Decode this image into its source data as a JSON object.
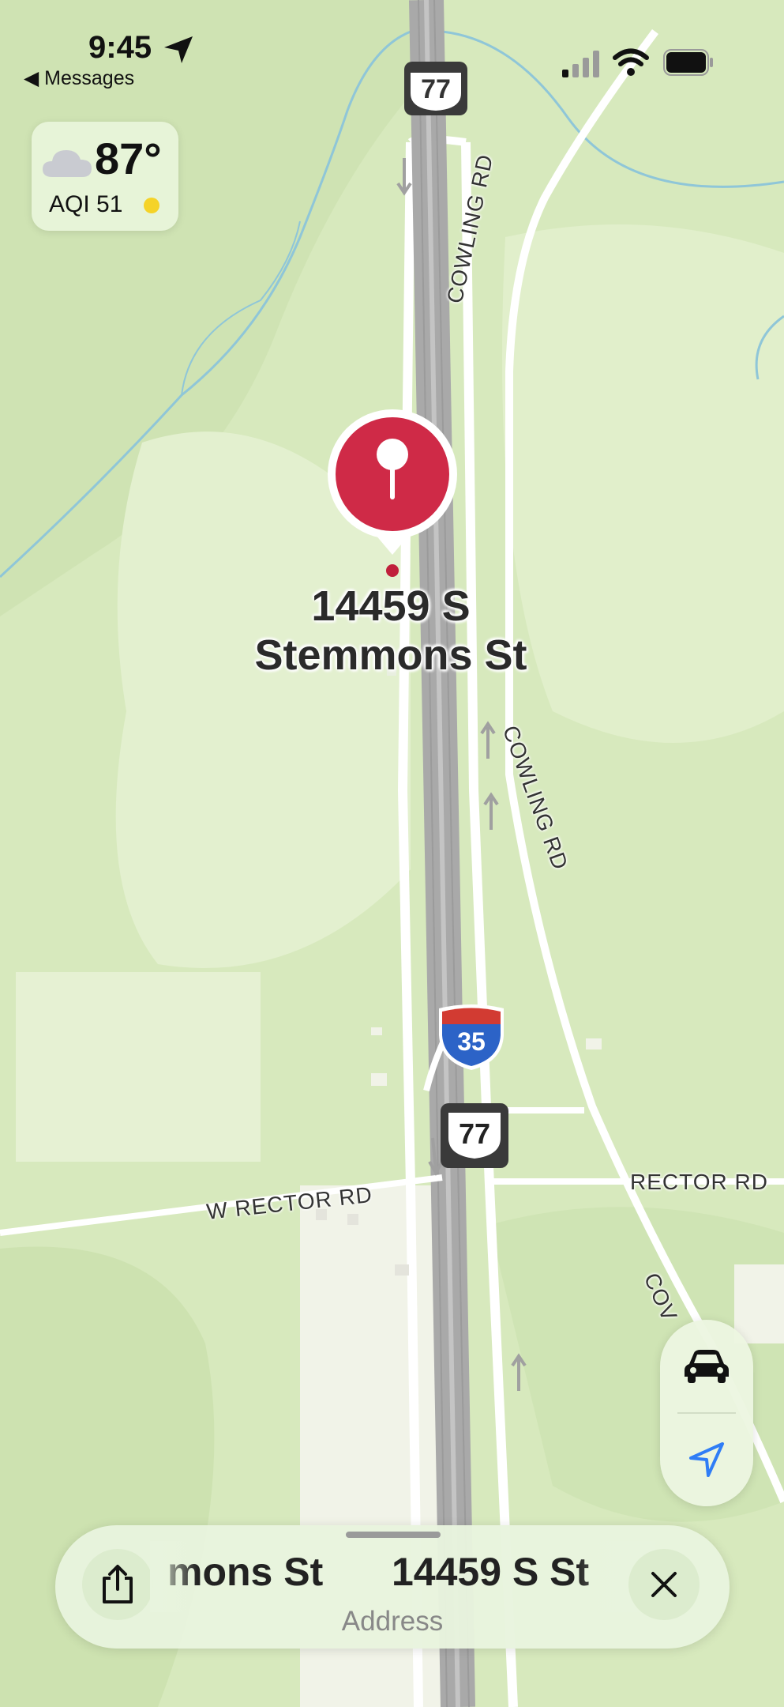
{
  "status_bar": {
    "time": "9:45",
    "back_label": "◀ Messages"
  },
  "weather": {
    "temperature": "87°",
    "aqi": "AQI 51",
    "aqi_color": "#f5d328"
  },
  "map": {
    "pin_label_line1": "14459 S",
    "pin_label_line2": "Stemmons St",
    "roads": {
      "cowling_top": "COWLING RD",
      "cowling_mid": "COWLING RD",
      "w_rector": "W RECTOR RD",
      "rector": "RECTOR RD",
      "cov": "COV"
    },
    "shields": {
      "us77_top": "77",
      "i35": "35",
      "us77": "77"
    }
  },
  "controls": {
    "drive_icon": "car-icon",
    "location_icon": "location-arrow-icon"
  },
  "bottom_card": {
    "title_scroll_a": "mons St",
    "title_scroll_b_main": "14459 ",
    "title_scroll_b_tail": "S St",
    "subtitle": "Address",
    "share_icon": "share-icon",
    "close_icon": "close-icon"
  },
  "colors": {
    "map_land": "#d7e9bd",
    "map_land_light": "#e3f0cf",
    "highway_gray": "#a9a9a9",
    "water": "#8fc6d8",
    "pin_red": "#cf2a47",
    "location_blue": "#2f7df6"
  }
}
